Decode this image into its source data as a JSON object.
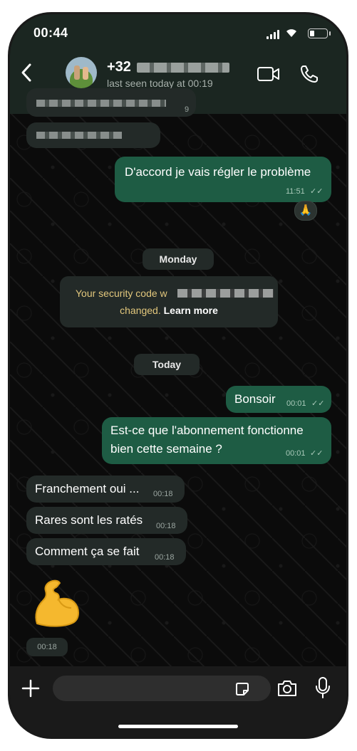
{
  "status_bar": {
    "time": "00:44"
  },
  "header": {
    "contact_name": "+32",
    "last_seen": "last seen today at 00:19"
  },
  "messages": [
    {
      "direction": "in",
      "text": "",
      "time": "9"
    },
    {
      "direction": "in",
      "text": "",
      "time": ""
    },
    {
      "direction": "out",
      "text": "D'accord je vais régler le problème",
      "time": "11:51",
      "reaction": "🙏"
    },
    {
      "direction": "system",
      "text": "Monday"
    },
    {
      "direction": "system-security",
      "text_before": "Your security code w",
      "text_after": "changed.",
      "link": "Learn more"
    },
    {
      "direction": "system",
      "text": "Today"
    },
    {
      "direction": "out",
      "text": "Bonsoir",
      "time": "00:01"
    },
    {
      "direction": "out",
      "text_line1": "Est-ce que l'abonnement fonctionne",
      "text_line2": "bien cette semaine ?",
      "time": "00:01"
    },
    {
      "direction": "in",
      "text": "Franchement oui ...",
      "time": "00:18"
    },
    {
      "direction": "in",
      "text": "Rares sont les ratés",
      "time": "00:18"
    },
    {
      "direction": "in",
      "text": "Comment ça se fait",
      "time": "00:18"
    },
    {
      "direction": "in",
      "emoji": "flexed-biceps",
      "time": "00:18"
    }
  ],
  "composer": {
    "placeholder": ""
  },
  "colors": {
    "outgoing": "#1e5c44",
    "incoming": "#232a28",
    "background": "#0b0b0b",
    "security_text": "#e2c77c"
  }
}
